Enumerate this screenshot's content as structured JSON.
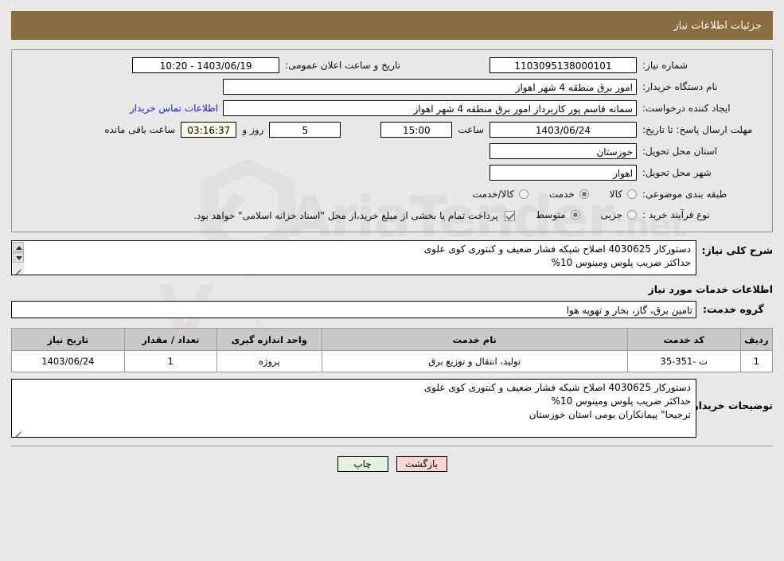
{
  "header": {
    "title": "جزئیات اطلاعات نیاز",
    "bar_color": "#8a6d3f"
  },
  "top_form": {
    "need_number_label": "شماره نیاز:",
    "need_number_value": "1103095138000101",
    "public_announce_label": "تاریخ و ساعت اعلان عمومی:",
    "public_announce_value": "1403/06/19 - 10:20",
    "buyer_org_label": "نام دستگاه خریدار:",
    "buyer_org_value": "امور برق منطقه 4 شهر اهواز",
    "requester_label": "ایجاد کننده درخواست:",
    "requester_value": "سمانه قاسم پور کاربرداز امور برق منطقه 4 شهر اهواز",
    "contact_link": "اطلاعات تماس خریدار",
    "deadline_label": "مهلت ارسال پاسخ: تا تاریخ:",
    "deadline_date": "1403/06/24",
    "hour_label": "ساعت",
    "deadline_time": "15:00",
    "days_left": "5",
    "days_word": "روز و",
    "time_left": "03:16:37",
    "time_left_suffix": "ساعت باقی مانده",
    "province_label": "استان محل تحویل:",
    "province_value": "خوزستان",
    "city_label": "شهر محل تحویل:",
    "city_value": "اهواز",
    "category_label": "طبقه بندی موضوعی:",
    "category_options": [
      {
        "label": "کالا",
        "selected": false
      },
      {
        "label": "خدمت",
        "selected": true
      },
      {
        "label": "کالا/خدمت",
        "selected": false
      }
    ],
    "process_label": "نوع فرآیند خرید :",
    "process_options": [
      {
        "label": "جزیی",
        "selected": false
      },
      {
        "label": "متوسط",
        "selected": true
      }
    ],
    "treasury_checkbox_checked": true,
    "treasury_text": "پرداخت تمام یا بخشی از مبلغ خرید،از محل \"اسناد خزانه اسلامی\" خواهد بود."
  },
  "description": {
    "label": "شرح کلی نیاز:",
    "value": "دستورکار 4030625 اصلاح شبکه فشار ضعیف و کنتوری کوی علوی\nحداکثر ضریب پلوس ومینوس 10%"
  },
  "services_section": {
    "heading": "اطلاعات خدمات مورد نیاز",
    "group_label": "گروه خدمت:",
    "group_value": "تامین برق، گاز، بخار و تهویه هوا"
  },
  "table": {
    "columns": [
      "ردیف",
      "کد خدمت",
      "نام خدمت",
      "واحد اندازه گیری",
      "تعداد / مقدار",
      "تاریخ نیاز"
    ],
    "rows": [
      {
        "row": "1",
        "code": "ت -351-35",
        "name": "تولید، انتقال و توزیع برق",
        "unit": "پروژه",
        "qty": "1",
        "date": "1403/06/24"
      }
    ]
  },
  "buyer_notes": {
    "label": "توضیحات خریدار:",
    "value": "دستورکار 4030625 اصلاح شبکه فشار ضعیف و کنتوری کوی علوی\nحداکثر ضریب پلوس ومینوس 10%\nترجیحا\" پیمانکاران بومی استان خوزستان"
  },
  "buttons": {
    "print": "چاپ",
    "back": "بازگشت"
  },
  "watermark": {
    "text_main": "AriaTender",
    "text_tld": ".net"
  }
}
